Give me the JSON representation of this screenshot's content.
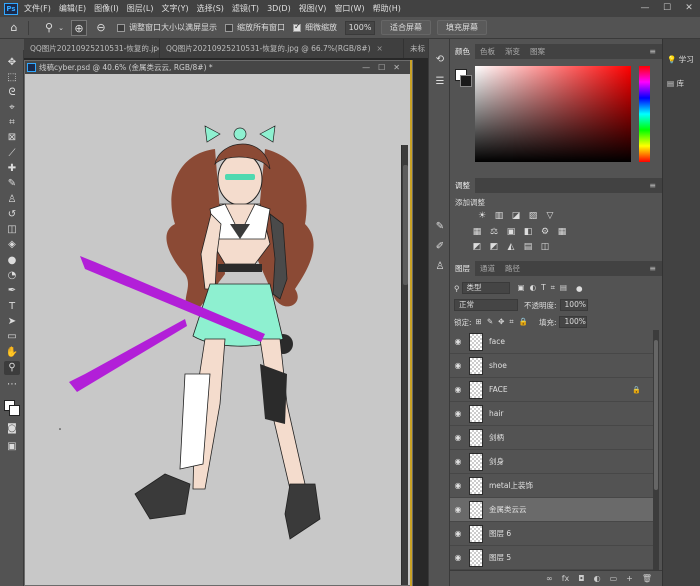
{
  "app": {
    "logo": "Ps"
  },
  "menu": {
    "items": [
      "文件(F)",
      "编辑(E)",
      "图像(I)",
      "图层(L)",
      "文字(Y)",
      "选择(S)",
      "滤镜(T)",
      "3D(D)",
      "视图(V)",
      "窗口(W)",
      "帮助(H)"
    ]
  },
  "window_controls": {
    "minimize": "—",
    "maximize": "☐",
    "close": "✕"
  },
  "options_bar": {
    "checkbox1": "调整窗口大小以满屏显示",
    "checkbox2": "缩放所有窗口",
    "checkbox3": "细微缩放",
    "zoom_value": "100%",
    "btn_fit": "适合屏幕",
    "btn_fill": "填充屏幕"
  },
  "doc_tabs": [
    {
      "label": "QQ图片20210925210531-恢复的.jpg",
      "close": "×"
    },
    {
      "label": "QQ图片20210925210531-恢复的.jpg @ 66.7%(RGB/8#)",
      "close": "×"
    },
    {
      "label": "未标",
      "close": ""
    }
  ],
  "document": {
    "title": "线稿cyber.psd @ 40.6% (金属类云云, RGB/8#) *",
    "controls": "—☐✕"
  },
  "color_panel": {
    "tabs": [
      "颜色",
      "色板",
      "渐变",
      "图案"
    ],
    "menu": "≡"
  },
  "adjustments_panel": {
    "tab": "调整",
    "subtitle": "添加调整",
    "menu": "≡",
    "row1": [
      "☀",
      "▥",
      "◪",
      "▨",
      "▽"
    ],
    "row2": [
      "▦",
      "⚖",
      "▣",
      "◧",
      "⚙",
      "▦"
    ],
    "row3": [
      "◩",
      "◩",
      "◭",
      "▤",
      "◫"
    ]
  },
  "layers_panel": {
    "tabs": [
      "图层",
      "通道",
      "路径"
    ],
    "menu": "≡",
    "filter_kind": "类型",
    "blend_mode": "正常",
    "opacity_label": "不透明度:",
    "opacity_value": "100%",
    "lock_label": "锁定:",
    "fill_label": "填充:",
    "fill_value": "100%",
    "layers": [
      {
        "name": "face",
        "selected": false,
        "locked": false
      },
      {
        "name": "shoe",
        "selected": false,
        "locked": false
      },
      {
        "name": "FACE",
        "selected": false,
        "locked": true
      },
      {
        "name": "hair",
        "selected": false,
        "locked": false
      },
      {
        "name": "剑柄",
        "selected": false,
        "locked": false
      },
      {
        "name": "剑身",
        "selected": false,
        "locked": false
      },
      {
        "name": "metal上装饰",
        "selected": false,
        "locked": false
      },
      {
        "name": "金属类云云",
        "selected": true,
        "locked": false
      },
      {
        "name": "图层 6",
        "selected": false,
        "locked": false
      },
      {
        "name": "图层 5",
        "selected": false,
        "locked": false
      }
    ],
    "bottom_buttons": [
      "∞",
      "fx",
      "◘",
      "◐",
      "▭",
      "+",
      "🗑"
    ]
  },
  "learn_panel": {
    "learn": "学习",
    "library": "库"
  },
  "colors": {
    "accent_ps": "#31a8ff",
    "sword": "#b21fd8",
    "outfit_teal": "#8ef0d0",
    "hair": "#8b4a35"
  }
}
